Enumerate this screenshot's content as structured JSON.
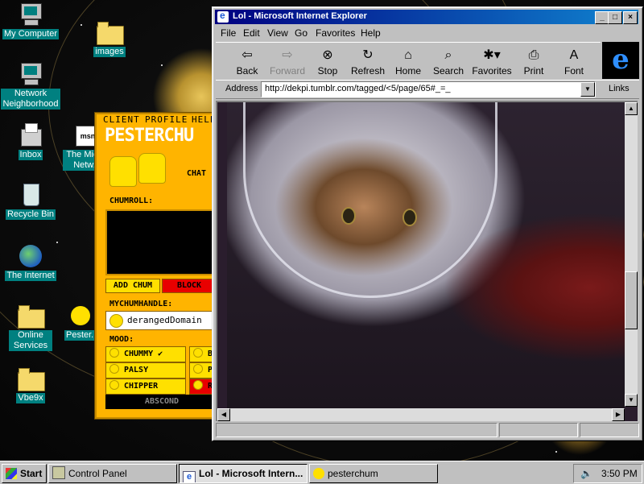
{
  "desktop": {
    "icons": [
      {
        "label": "My Computer"
      },
      {
        "label": "Network Neighborhood"
      },
      {
        "label": "Inbox"
      },
      {
        "label": "Recycle Bin"
      },
      {
        "label": "The Internet"
      },
      {
        "label": "Online Services"
      },
      {
        "label": "Vbe9x"
      },
      {
        "label": "images"
      },
      {
        "label": "The Micr... Netw..."
      },
      {
        "label": "Pester..."
      }
    ]
  },
  "pesterchum": {
    "menu": [
      "CLIENT",
      "PROFILE",
      "HELP"
    ],
    "title": "PESTERCHU",
    "chat_label": "CHAT",
    "chumroll_label": "CHUMROLL:",
    "add_chum": "ADD CHUM",
    "block": "BLOCK",
    "handle_label": "MYCHUMHANDLE:",
    "handle": "derangedDomain",
    "mood_label": "MOOD:",
    "moods": [
      {
        "label": "CHUMMY ✔"
      },
      {
        "label": "PALSY"
      },
      {
        "label": "CHIPPER"
      },
      {
        "label": "B"
      },
      {
        "label": "P"
      },
      {
        "label": "R"
      }
    ],
    "abscond": "ABSCOND"
  },
  "ie": {
    "title": "Lol - Microsoft Internet Explorer",
    "menu": [
      "File",
      "Edit",
      "View",
      "Go",
      "Favorites",
      "Help"
    ],
    "toolbar": [
      {
        "label": "Back",
        "icon": "back-arrow-icon"
      },
      {
        "label": "Forward",
        "icon": "forward-arrow-icon"
      },
      {
        "label": "Stop",
        "icon": "stop-icon"
      },
      {
        "label": "Refresh",
        "icon": "refresh-icon"
      },
      {
        "label": "Home",
        "icon": "home-icon"
      },
      {
        "label": "Search",
        "icon": "search-icon"
      },
      {
        "label": "Favorites",
        "icon": "favorites-icon"
      },
      {
        "label": "Print",
        "icon": "print-icon"
      },
      {
        "label": "Font",
        "icon": "font-icon"
      }
    ],
    "address_label": "Address",
    "url": "http://dekpi.tumblr.com/tagged/<5/page/65#_=_",
    "links_label": "Links"
  },
  "taskbar": {
    "start": "Start",
    "buttons": [
      {
        "label": "Control Panel"
      },
      {
        "label": "Lol - Microsoft Intern..."
      },
      {
        "label": "pesterchum"
      }
    ],
    "clock": "3:50 PM"
  },
  "colors": {
    "pester_orange": "#ffb400",
    "pester_yellow": "#ffe000",
    "title_blue": "#000080",
    "teal_label": "#008080"
  }
}
